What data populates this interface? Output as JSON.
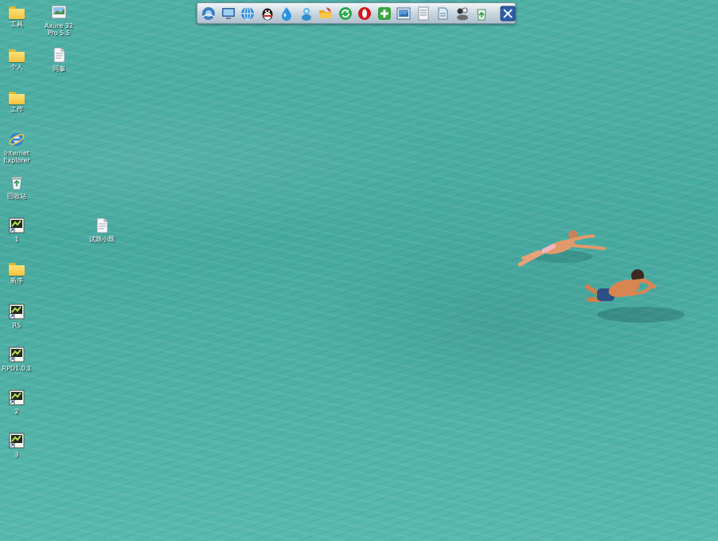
{
  "desktop": {
    "icons": [
      {
        "name": "folder-icon",
        "label": "工具"
      },
      {
        "name": "app-icon",
        "label": "Axure 32\nPro 5.5"
      },
      {
        "name": "folder-icon",
        "label": "个人"
      },
      {
        "name": "document-icon",
        "label": "同事"
      },
      {
        "name": "folder-icon",
        "label": "工作"
      },
      {
        "name": "internet-explorer-icon",
        "label": "Internet\nExplorer"
      },
      {
        "name": "recycle-bin-icon",
        "label": "回收站"
      },
      {
        "name": "shortcut-icon",
        "label": "1"
      },
      {
        "name": "document-icon",
        "label": "试题小题"
      },
      {
        "name": "folder-icon",
        "label": "新序"
      },
      {
        "name": "shortcut-icon",
        "label": "RS"
      },
      {
        "name": "shortcut-icon",
        "label": "RPD1.0.1"
      },
      {
        "name": "shortcut-icon",
        "label": "2"
      },
      {
        "name": "shortcut-icon",
        "label": "3"
      }
    ]
  },
  "dock": {
    "items": [
      {
        "name": "network-icon"
      },
      {
        "name": "monitor-icon"
      },
      {
        "name": "browser-icon"
      },
      {
        "name": "qq-penguin-icon"
      },
      {
        "name": "water-drop-icon"
      },
      {
        "name": "messenger-icon"
      },
      {
        "name": "folder-app-icon"
      },
      {
        "name": "refresh-icon"
      },
      {
        "name": "opera-icon"
      },
      {
        "name": "plus-icon"
      },
      {
        "name": "image-viewer-icon"
      },
      {
        "name": "notepad-icon"
      },
      {
        "name": "document-app-icon"
      },
      {
        "name": "contacts-icon"
      },
      {
        "name": "recycle-icon"
      },
      {
        "name": "settings-tools-icon"
      }
    ]
  },
  "colors": {
    "water": "#4fb0a6",
    "dock_border": "#7d93a4",
    "label_text": "#ffffff"
  }
}
